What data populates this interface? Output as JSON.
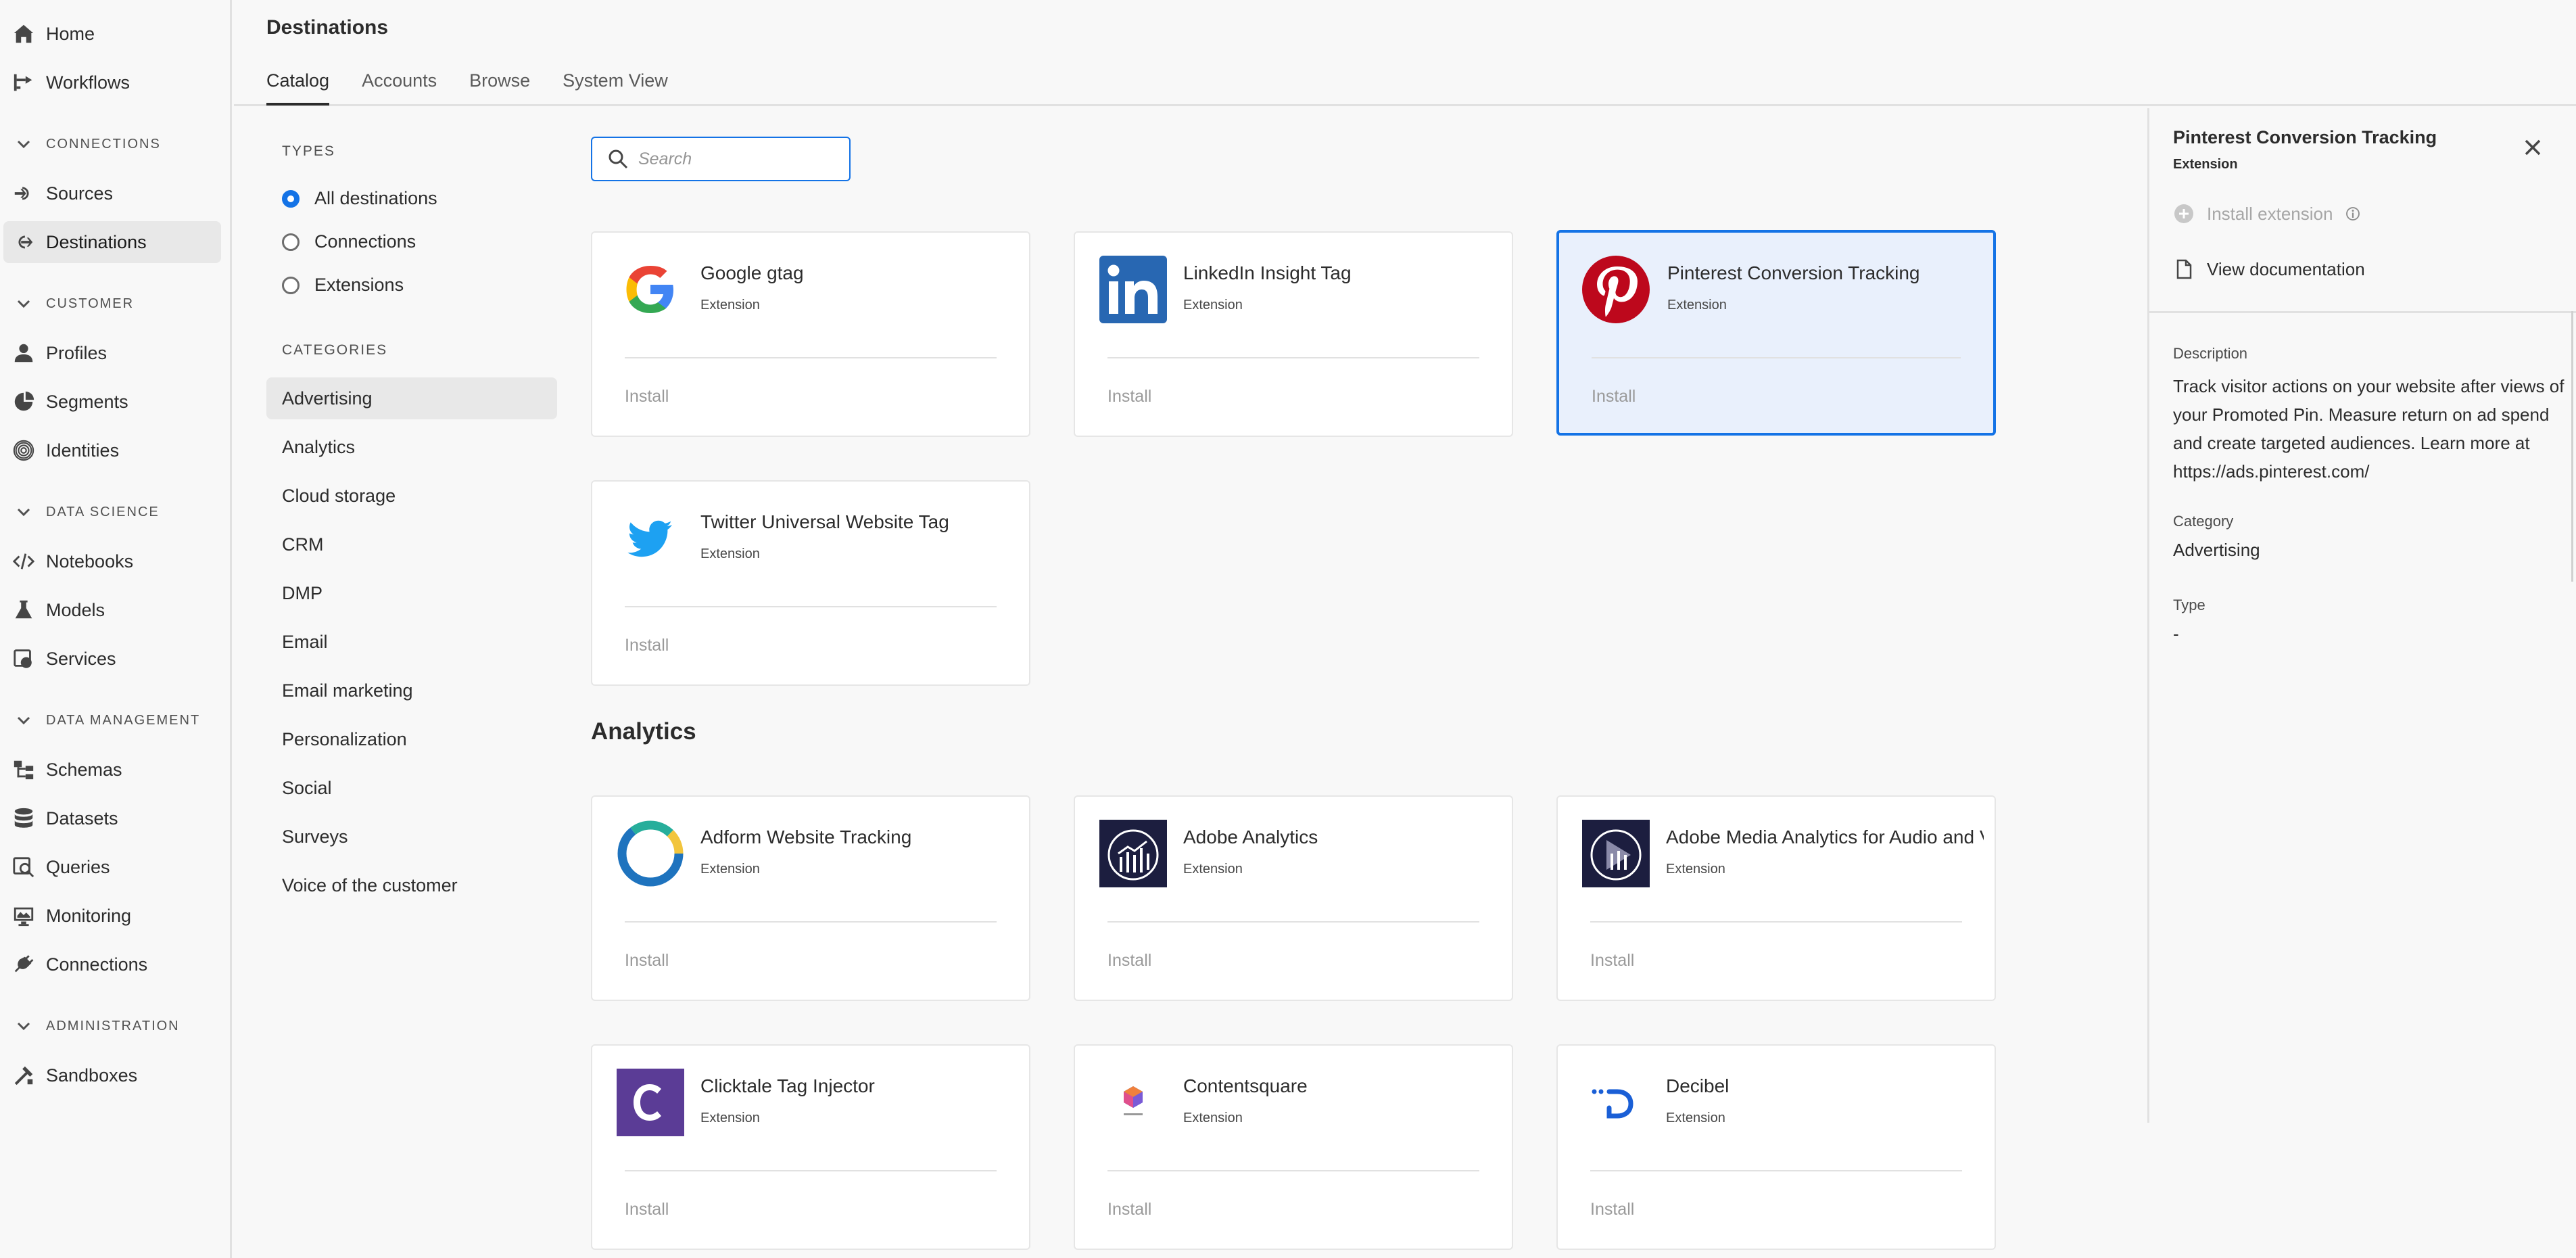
{
  "nav": {
    "home": "Home",
    "workflows": "Workflows",
    "sections": {
      "connections": "CONNECTIONS",
      "customer": "CUSTOMER",
      "data_science": "DATA SCIENCE",
      "data_management": "DATA MANAGEMENT",
      "administration": "ADMINISTRATION"
    },
    "sources": "Sources",
    "destinations": "Destinations",
    "profiles": "Profiles",
    "segments": "Segments",
    "identities": "Identities",
    "notebooks": "Notebooks",
    "models": "Models",
    "services": "Services",
    "schemas": "Schemas",
    "datasets": "Datasets",
    "queries": "Queries",
    "monitoring": "Monitoring",
    "connections_item": "Connections",
    "sandboxes": "Sandboxes"
  },
  "header": {
    "title": "Destinations",
    "tabs": [
      "Catalog",
      "Accounts",
      "Browse",
      "System View"
    ],
    "selected_tab": "Catalog"
  },
  "filters": {
    "types_heading": "TYPES",
    "types": [
      "All destinations",
      "Connections",
      "Extensions"
    ],
    "selected_type": "All destinations",
    "categories_heading": "CATEGORIES",
    "categories": [
      "Advertising",
      "Analytics",
      "Cloud storage",
      "CRM",
      "DMP",
      "Email",
      "Email marketing",
      "Personalization",
      "Social",
      "Surveys",
      "Voice of the customer"
    ],
    "selected_category": "Advertising"
  },
  "search": {
    "placeholder": "Search"
  },
  "cards": [
    {
      "title": "Google gtag",
      "subtitle": "Extension",
      "action": "Install",
      "logo": "google-logo"
    },
    {
      "title": "LinkedIn Insight Tag",
      "subtitle": "Extension",
      "action": "Install",
      "logo": "linkedin-logo"
    },
    {
      "title": "Pinterest Conversion Tracking",
      "subtitle": "Extension",
      "action": "Install",
      "logo": "pinterest-logo",
      "selected": true
    },
    {
      "title": "Twitter Universal Website Tag",
      "subtitle": "Extension",
      "action": "Install",
      "logo": "twitter-logo"
    }
  ],
  "analytics": {
    "heading": "Analytics",
    "cards": [
      {
        "title": "Adform Website Tracking",
        "subtitle": "Extension",
        "action": "Install",
        "logo": "adform-logo"
      },
      {
        "title": "Adobe Analytics",
        "subtitle": "Extension",
        "action": "Install",
        "logo": "adobe-analytics-logo"
      },
      {
        "title": "Adobe Media Analytics for Audio and V",
        "subtitle": "Extension",
        "action": "Install",
        "logo": "adobe-media-analytics-logo"
      },
      {
        "title": "Clicktale Tag Injector",
        "subtitle": "Extension",
        "action": "Install",
        "logo": "clicktale-logo"
      },
      {
        "title": "Contentsquare",
        "subtitle": "Extension",
        "action": "Install",
        "logo": "contentsquare-logo"
      },
      {
        "title": "Decibel",
        "subtitle": "Extension",
        "action": "Install",
        "logo": "decibel-logo"
      }
    ]
  },
  "panel": {
    "title": "Pinterest Conversion Tracking",
    "subtitle": "Extension",
    "install": "Install extension",
    "docs": "View documentation",
    "description_label": "Description",
    "description": "Track visitor actions on your website after views of your Promoted Pin. Measure return on ad spend and create targeted audiences. Learn more at https://ads.pinterest.com/",
    "category_label": "Category",
    "category": "Advertising",
    "type_label": "Type",
    "type": "-"
  },
  "colors": {
    "accent": "#1473e6",
    "selected_card_bg": "#e9f0fc",
    "linkedin": "#2867b2",
    "pinterest": "#bd081c",
    "twitter": "#1da1f2",
    "clicktale": "#5b3c96",
    "decibel": "#1a5fd6"
  }
}
